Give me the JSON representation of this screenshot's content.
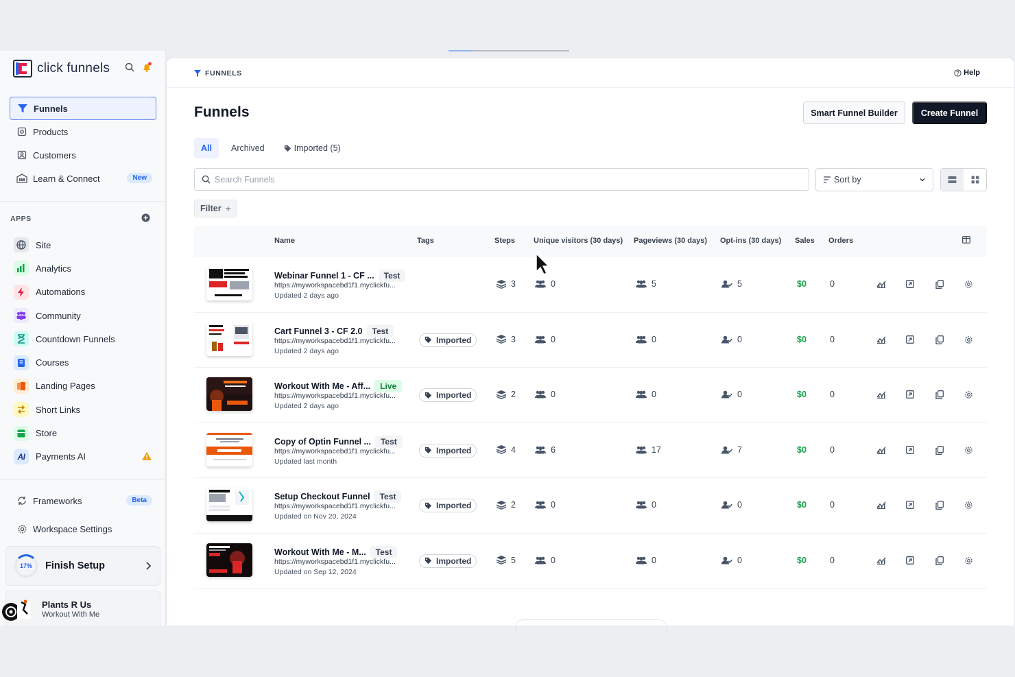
{
  "brand": {
    "name": "click funnels"
  },
  "sidebar": {
    "nav": [
      {
        "label": "Funnels",
        "icon": "funnel-icon",
        "active": true
      },
      {
        "label": "Products",
        "icon": "box-icon"
      },
      {
        "label": "Customers",
        "icon": "contact-icon"
      },
      {
        "label": "Learn & Connect",
        "icon": "building-icon",
        "badge": "New"
      }
    ],
    "apps_heading": "APPS",
    "apps": [
      {
        "label": "Site",
        "icon": "globe-icon",
        "color": "#4b5563",
        "bg": "#e5e7eb"
      },
      {
        "label": "Analytics",
        "icon": "bar-chart-icon",
        "color": "#16a34a",
        "bg": "#dcfce7"
      },
      {
        "label": "Automations",
        "icon": "lightning-icon",
        "color": "#e11d48",
        "bg": "#ffe4e6"
      },
      {
        "label": "Community",
        "icon": "people-icon",
        "color": "#7c3aed",
        "bg": "#ede9fe"
      },
      {
        "label": "Countdown Funnels",
        "icon": "hourglass-icon",
        "color": "#0d9488",
        "bg": "#ccfbf1"
      },
      {
        "label": "Courses",
        "icon": "book-icon",
        "color": "#2563eb",
        "bg": "#dbeafe"
      },
      {
        "label": "Landing Pages",
        "icon": "pages-icon",
        "color": "#ea580c",
        "bg": "#ffedd5"
      },
      {
        "label": "Short Links",
        "icon": "arrows-icon",
        "color": "#ca8a04",
        "bg": "#fef9c3"
      },
      {
        "label": "Store",
        "icon": "store-icon",
        "color": "#16a34a",
        "bg": "#dcfce7"
      },
      {
        "label": "Payments AI",
        "icon": "ai-icon",
        "color": "#1e3a8a",
        "bg": "#dbeafe"
      }
    ],
    "frameworks": {
      "label": "Frameworks",
      "badge": "Beta"
    },
    "workspace_settings": "Workspace Settings",
    "setup": {
      "percent": "17%",
      "label": "Finish Setup",
      "progress": 0.17
    },
    "workspace": {
      "name": "Plants R Us",
      "sub": "Workout With Me"
    }
  },
  "header": {
    "breadcrumb": "FUNNELS",
    "help": "Help"
  },
  "page": {
    "title": "Funnels",
    "smart_button": "Smart Funnel Builder",
    "create_button": "Create Funnel",
    "tabs": [
      {
        "label": "All",
        "active": true
      },
      {
        "label": "Archived"
      },
      {
        "label": "Imported (5)",
        "icon": "tag-icon"
      }
    ],
    "search_placeholder": "Search Funnels",
    "sort_label": "Sort by",
    "filter_label": "Filter"
  },
  "table": {
    "columns": [
      "Name",
      "Tags",
      "Steps",
      "Unique visitors (30 days)",
      "Pageviews (30 days)",
      "Opt-ins (30 days)",
      "Sales",
      "Orders"
    ],
    "rows": [
      {
        "name": "Webinar Funnel 1 - CF ...",
        "status": "Test",
        "url": "https://myworkspacebd1f1.myclickfu...",
        "updated": "Updated 2 days ago",
        "tag": "",
        "steps": "3",
        "visitors": "0",
        "pageviews": "5",
        "optins": "5",
        "sales": "$0",
        "orders": "0",
        "thumb": "webinar"
      },
      {
        "name": "Cart Funnel 3 - CF 2.0",
        "status": "Test",
        "url": "https://myworkspacebd1f1.myclickfu...",
        "updated": "Updated 2 days ago",
        "tag": "Imported",
        "steps": "3",
        "visitors": "0",
        "pageviews": "0",
        "optins": "0",
        "sales": "$0",
        "orders": "0",
        "thumb": "cart"
      },
      {
        "name": "Workout With Me - Aff...",
        "status": "Live",
        "url": "https://myworkspacebd1f1.myclickfu...",
        "updated": "Updated 2 days ago",
        "tag": "Imported",
        "steps": "2",
        "visitors": "0",
        "pageviews": "0",
        "optins": "0",
        "sales": "$0",
        "orders": "0",
        "thumb": "affiliate"
      },
      {
        "name": "Copy of Optin Funnel ...",
        "status": "Test",
        "url": "https://myworkspacebd1f1.myclickfu...",
        "updated": "Updated last month",
        "tag": "Imported",
        "steps": "4",
        "visitors": "6",
        "pageviews": "17",
        "optins": "7",
        "sales": "$0",
        "orders": "0",
        "thumb": "optin"
      },
      {
        "name": "Setup Checkout Funnel",
        "status": "Test",
        "url": "https://myworkspacebd1f1.myclickfu...",
        "updated": "Updated on Nov 20, 2024",
        "tag": "Imported",
        "steps": "2",
        "visitors": "0",
        "pageviews": "0",
        "optins": "0",
        "sales": "$0",
        "orders": "0",
        "thumb": "checkout"
      },
      {
        "name": "Workout With Me - M...",
        "status": "Test",
        "url": "https://myworkspacebd1f1.myclickfu...",
        "updated": "Updated on Sep 12, 2024",
        "tag": "Imported",
        "steps": "5",
        "visitors": "0",
        "pageviews": "0",
        "optins": "0",
        "sales": "$0",
        "orders": "0",
        "thumb": "workout"
      }
    ]
  },
  "colors": {
    "accent": "#2563eb",
    "sales": "#16a34a",
    "primary_button": "#111827"
  }
}
